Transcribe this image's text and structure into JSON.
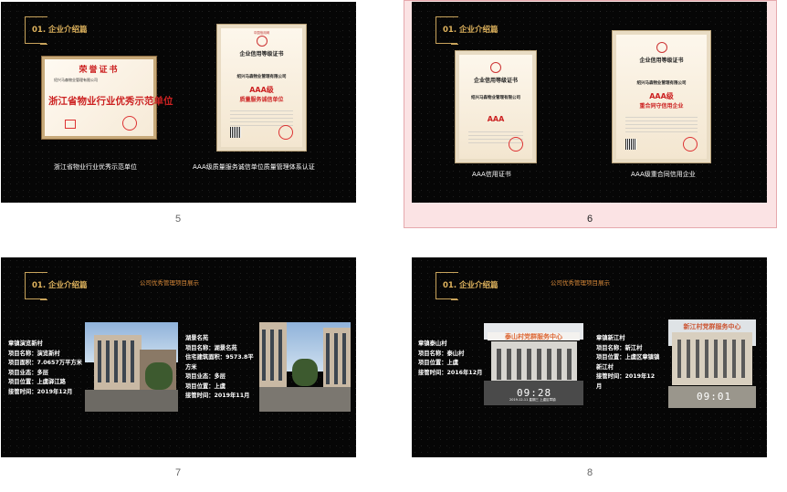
{
  "section_title": "01. 企业介绍篇",
  "projects_header": "公司优秀管理项目展示",
  "accent_color": "#e0b45e",
  "selected_slide": "6",
  "slides": [
    {
      "number": "5",
      "captions": [
        "浙江省物业行业优秀示范单位",
        "AAA级质量服务诚信单位质量管理体系认证"
      ],
      "cert_wide": {
        "title": "荣誉证书",
        "line": "绍兴马森物业管理有限公司",
        "main": "浙江省物业行业优秀示范单位"
      },
      "cert_tall": {
        "header": "中国信用网",
        "title": "企业信用等级证书",
        "company": "绍兴马森物业管理有限公司",
        "aaa": "AAA级",
        "grade": "质量服务诚信单位"
      }
    },
    {
      "number": "6",
      "captions": [
        "AAA信用证书",
        "AAA级重合同信用企业"
      ],
      "cert_left": {
        "title": "企业信用等级证书",
        "company": "绍兴马森物业管理有限公司",
        "aaa": "AAA"
      },
      "cert_right": {
        "title": "企业信用等级证书",
        "company": "绍兴马森物业管理有限公司",
        "aaa": "AAA级",
        "grade": "重合同守信用企业"
      }
    },
    {
      "number": "7",
      "project_a": [
        "章镇演览新村",
        "项目名称：演览新村",
        "项目面积：7.0657万平方米",
        "项目业态：多层",
        "项目位置：上虞驿江路",
        "接管时间：2019年12月"
      ],
      "project_b": [
        "湖景名苑",
        "项目名称：湖景名苑",
        "住宅建筑面积：9573.8平",
        "方米",
        "项目业态：多层",
        "项目位置：上虞",
        "接管时间：2019年11月"
      ]
    },
    {
      "number": "8",
      "project_a": [
        "章镇泰山村",
        "项目名称：泰山村",
        "项目位置：上虞",
        "接管时间：2016年12月"
      ],
      "project_b": [
        "章镇新江村",
        "项目名称：新江村",
        "项目位置：上虞区章镇镇",
        "新江村",
        "接管时间：2019年12",
        "月"
      ],
      "photo_a": {
        "banner": "泰山村党群服务中心",
        "time": "09:28",
        "date": "2019-12-11 星期三 上虞区章镇"
      },
      "photo_b": {
        "banner": "新江村党群服务中心",
        "time": "09:01"
      }
    }
  ]
}
